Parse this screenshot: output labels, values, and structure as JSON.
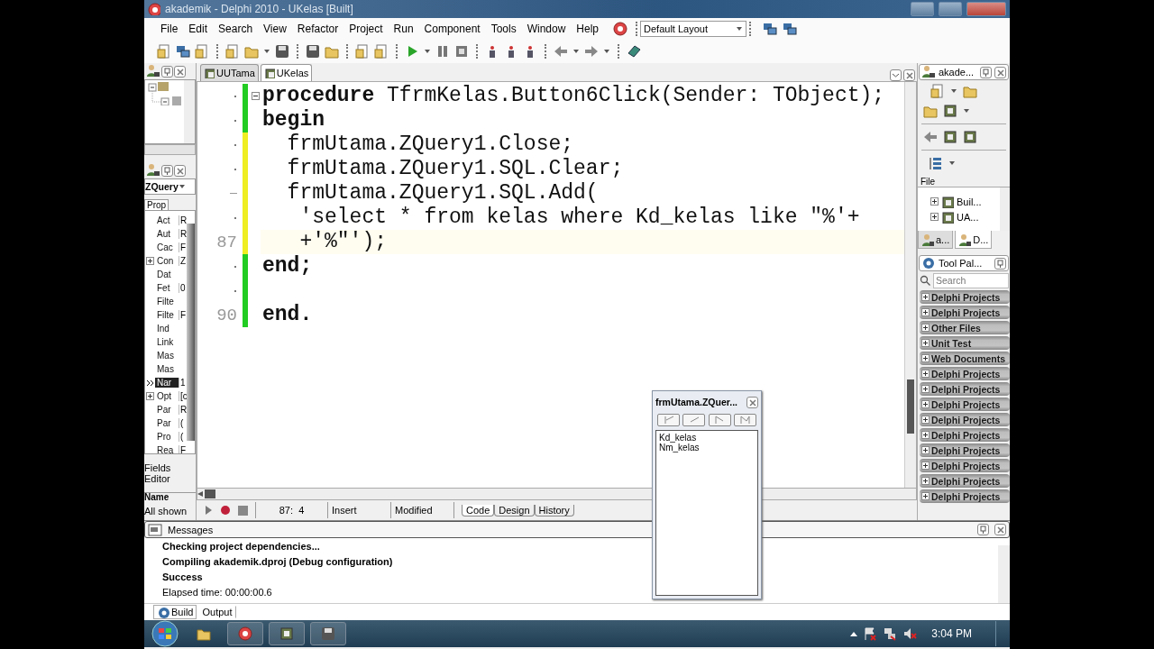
{
  "window": {
    "title": "akademik - Delphi 2010 - UKelas [Built]"
  },
  "menu": [
    "File",
    "Edit",
    "Search",
    "View",
    "Refactor",
    "Project",
    "Run",
    "Component",
    "Tools",
    "Window",
    "Help"
  ],
  "layout_select": {
    "value": "Default Layout"
  },
  "editor_tabs": [
    {
      "label": "UUTama",
      "selected": false
    },
    {
      "label": "UKelas",
      "selected": true
    }
  ],
  "object_inspector": {
    "component": "ZQuery",
    "tab": "Prop",
    "properties": [
      {
        "name": "Act",
        "value": "R",
        "expandable": false,
        "selected": false
      },
      {
        "name": "Aut",
        "value": "R",
        "expandable": false,
        "selected": false
      },
      {
        "name": "Cac",
        "value": "F",
        "expandable": false,
        "selected": false
      },
      {
        "name": "Con",
        "value": "Z",
        "expandable": true,
        "selected": false
      },
      {
        "name": "Dat",
        "expandable": false,
        "selected": false
      },
      {
        "name": "Fet",
        "value": "0",
        "expandable": false,
        "selected": false
      },
      {
        "name": "Filte",
        "expandable": false,
        "selected": false
      },
      {
        "name": "Filte",
        "value": "F",
        "expandable": false,
        "selected": false
      },
      {
        "name": "Ind",
        "expandable": false,
        "selected": false
      },
      {
        "name": "Link",
        "expandable": false,
        "selected": false
      },
      {
        "name": "Mas",
        "expandable": false,
        "selected": false
      },
      {
        "name": "Mas",
        "expandable": false,
        "selected": false
      },
      {
        "name": "Nar",
        "value": "1",
        "expandable": false,
        "selected": true
      },
      {
        "name": "Opt",
        "value": "[c",
        "expandable": true,
        "selected": false
      },
      {
        "name": "Par",
        "value": "R",
        "expandable": false,
        "selected": false
      },
      {
        "name": "Par",
        "value": "(",
        "expandable": false,
        "selected": false
      },
      {
        "name": "Pro",
        "value": "(",
        "expandable": false,
        "selected": false
      },
      {
        "name": "Rea",
        "value": "F",
        "expandable": false,
        "selected": false
      }
    ],
    "fields_editor": "Fields Editor",
    "footer_label": "Name",
    "filter": "All shown"
  },
  "code_lines": [
    {
      "kind": "dot",
      "color": "#22cc22",
      "current": false,
      "segments": [
        {
          "text": "procedure",
          "bold": true
        },
        {
          "text": " TfrmKelas.Button6Click(Sender: TObject);",
          "bold": false
        }
      ]
    },
    {
      "kind": "dot",
      "color": "#22cc22",
      "current": false,
      "segments": [
        {
          "text": "begin",
          "bold": true
        }
      ]
    },
    {
      "kind": "dot",
      "color": "#eeee22",
      "current": false,
      "segments": [
        {
          "text": "  frmUtama.ZQuery1.Close;",
          "bold": false
        }
      ]
    },
    {
      "kind": "dot",
      "color": "#eeee22",
      "current": false,
      "segments": [
        {
          "text": "  frmUtama.ZQuery1.SQL.Clear;",
          "bold": false
        }
      ]
    },
    {
      "kind": "dash",
      "color": "#eeee22",
      "current": false,
      "segments": [
        {
          "text": "  frmUtama.ZQuery1.SQL.Add(",
          "bold": false
        }
      ]
    },
    {
      "kind": "dot",
      "color": "#eeee22",
      "current": false,
      "segments": [
        {
          "text": "   'select * from kelas where Kd_kelas like \"%'+",
          "bold": false
        }
      ]
    },
    {
      "kind": "number",
      "number": "87",
      "color": "#eeee22",
      "current": true,
      "segments": [
        {
          "text": "   +'%\"');",
          "bold": false
        }
      ]
    },
    {
      "kind": "dot",
      "color": "#22cc22",
      "current": false,
      "segments": [
        {
          "text": "end;",
          "bold": true
        }
      ]
    },
    {
      "kind": "dot",
      "color": "#22cc22"
    },
    {
      "kind": "number",
      "number": "90",
      "color": "#22cc22",
      "current": false,
      "segments": [
        {
          "text": "end.",
          "bold": true
        }
      ]
    }
  ],
  "status": {
    "position": "87:  4",
    "mode": "Insert",
    "state": "Modified",
    "view_tabs": [
      {
        "label": "Code",
        "selected": true
      },
      {
        "label": "Design",
        "selected": false
      },
      {
        "label": "History",
        "selected": false
      }
    ]
  },
  "project_manager": {
    "title": "akade...",
    "column": "File",
    "items": [
      "Buil...",
      "UA..."
    ],
    "tabs": [
      {
        "label": "a...",
        "selected": true
      },
      {
        "label": "D...",
        "selected": false
      }
    ]
  },
  "tool_palette": {
    "title": "Tool Pal...",
    "search": {
      "placeholder": "Search"
    },
    "categories": [
      "Delphi Projects",
      "Delphi Projects",
      "Other Files",
      "Unit Test",
      "Web Documents",
      "Delphi Projects",
      "Delphi Projects",
      "Delphi Projects",
      "Delphi Projects",
      "Delphi Projects",
      "Delphi Projects",
      "Delphi Projects",
      "Delphi Projects",
      "Delphi Projects"
    ]
  },
  "field_list_window": {
    "title": "frmUtama.ZQuer...",
    "fields": [
      "Kd_kelas",
      "Nm_kelas"
    ]
  },
  "messages": {
    "title": "Messages",
    "lines": [
      {
        "text": "Checking project dependencies...",
        "bold": true
      },
      {
        "text": "Compiling akademik.dproj (Debug configuration)",
        "bold": true
      },
      {
        "text": "Success",
        "bold": true
      },
      {
        "text": "Elapsed time: 00:00:00.6",
        "bold": false
      }
    ],
    "tabs": [
      {
        "label": "Build",
        "selected": true
      },
      {
        "label": "Output",
        "selected": false
      }
    ]
  },
  "taskbar": {
    "clock": "3:04 PM"
  }
}
